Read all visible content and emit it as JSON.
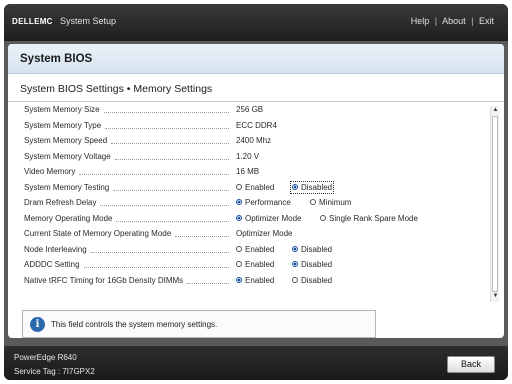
{
  "topbar": {
    "logo": "DELLEMC",
    "app_title": "System Setup",
    "help": "Help",
    "about": "About",
    "exit": "Exit",
    "separator": "|"
  },
  "header": {
    "title": "System BIOS",
    "subtitle": "System BIOS Settings • Memory Settings"
  },
  "settings": [
    {
      "label": "System Memory Size",
      "value": "256 GB"
    },
    {
      "label": "System Memory Type",
      "value": "ECC DDR4"
    },
    {
      "label": "System Memory Speed",
      "value": "2400 Mhz"
    },
    {
      "label": "System Memory Voltage",
      "value": "1.20 V"
    },
    {
      "label": "Video Memory",
      "value": "16 MB"
    },
    {
      "label": "System Memory Testing",
      "options": [
        "Enabled",
        "Disabled"
      ],
      "selected": "Disabled"
    },
    {
      "label": "Dram Refresh Delay",
      "options": [
        "Performance",
        "Minimum"
      ],
      "selected": "Performance"
    },
    {
      "label": "Memory Operating Mode",
      "options": [
        "Optimizer Mode",
        "Single Rank Spare Mode"
      ],
      "selected": "Optimizer Mode"
    },
    {
      "label": "Current State of Memory Operating Mode",
      "value": "Optimizer Mode"
    },
    {
      "label": "Node Interleaving",
      "options": [
        "Enabled",
        "Disabled"
      ],
      "selected": "Disabled"
    },
    {
      "label": "ADDDC Setting",
      "options": [
        "Enabled",
        "Disabled"
      ],
      "selected": "Disabled"
    },
    {
      "label": "Native tRFC Timing for 16Gb Density DIMMs",
      "options": [
        "Enabled",
        "Disabled"
      ],
      "selected": "Enabled"
    }
  ],
  "help_box": {
    "icon": "info-icon",
    "text": "This field controls the system memory settings."
  },
  "footer": {
    "model": "PowerEdge R640",
    "service_tag": "Service Tag : 7I7GPX2",
    "back_label": "Back"
  },
  "colors": {
    "accent": "#1a4fa0",
    "header_bg": "#dce8f2",
    "bar_bg": "#1e1e1e"
  }
}
